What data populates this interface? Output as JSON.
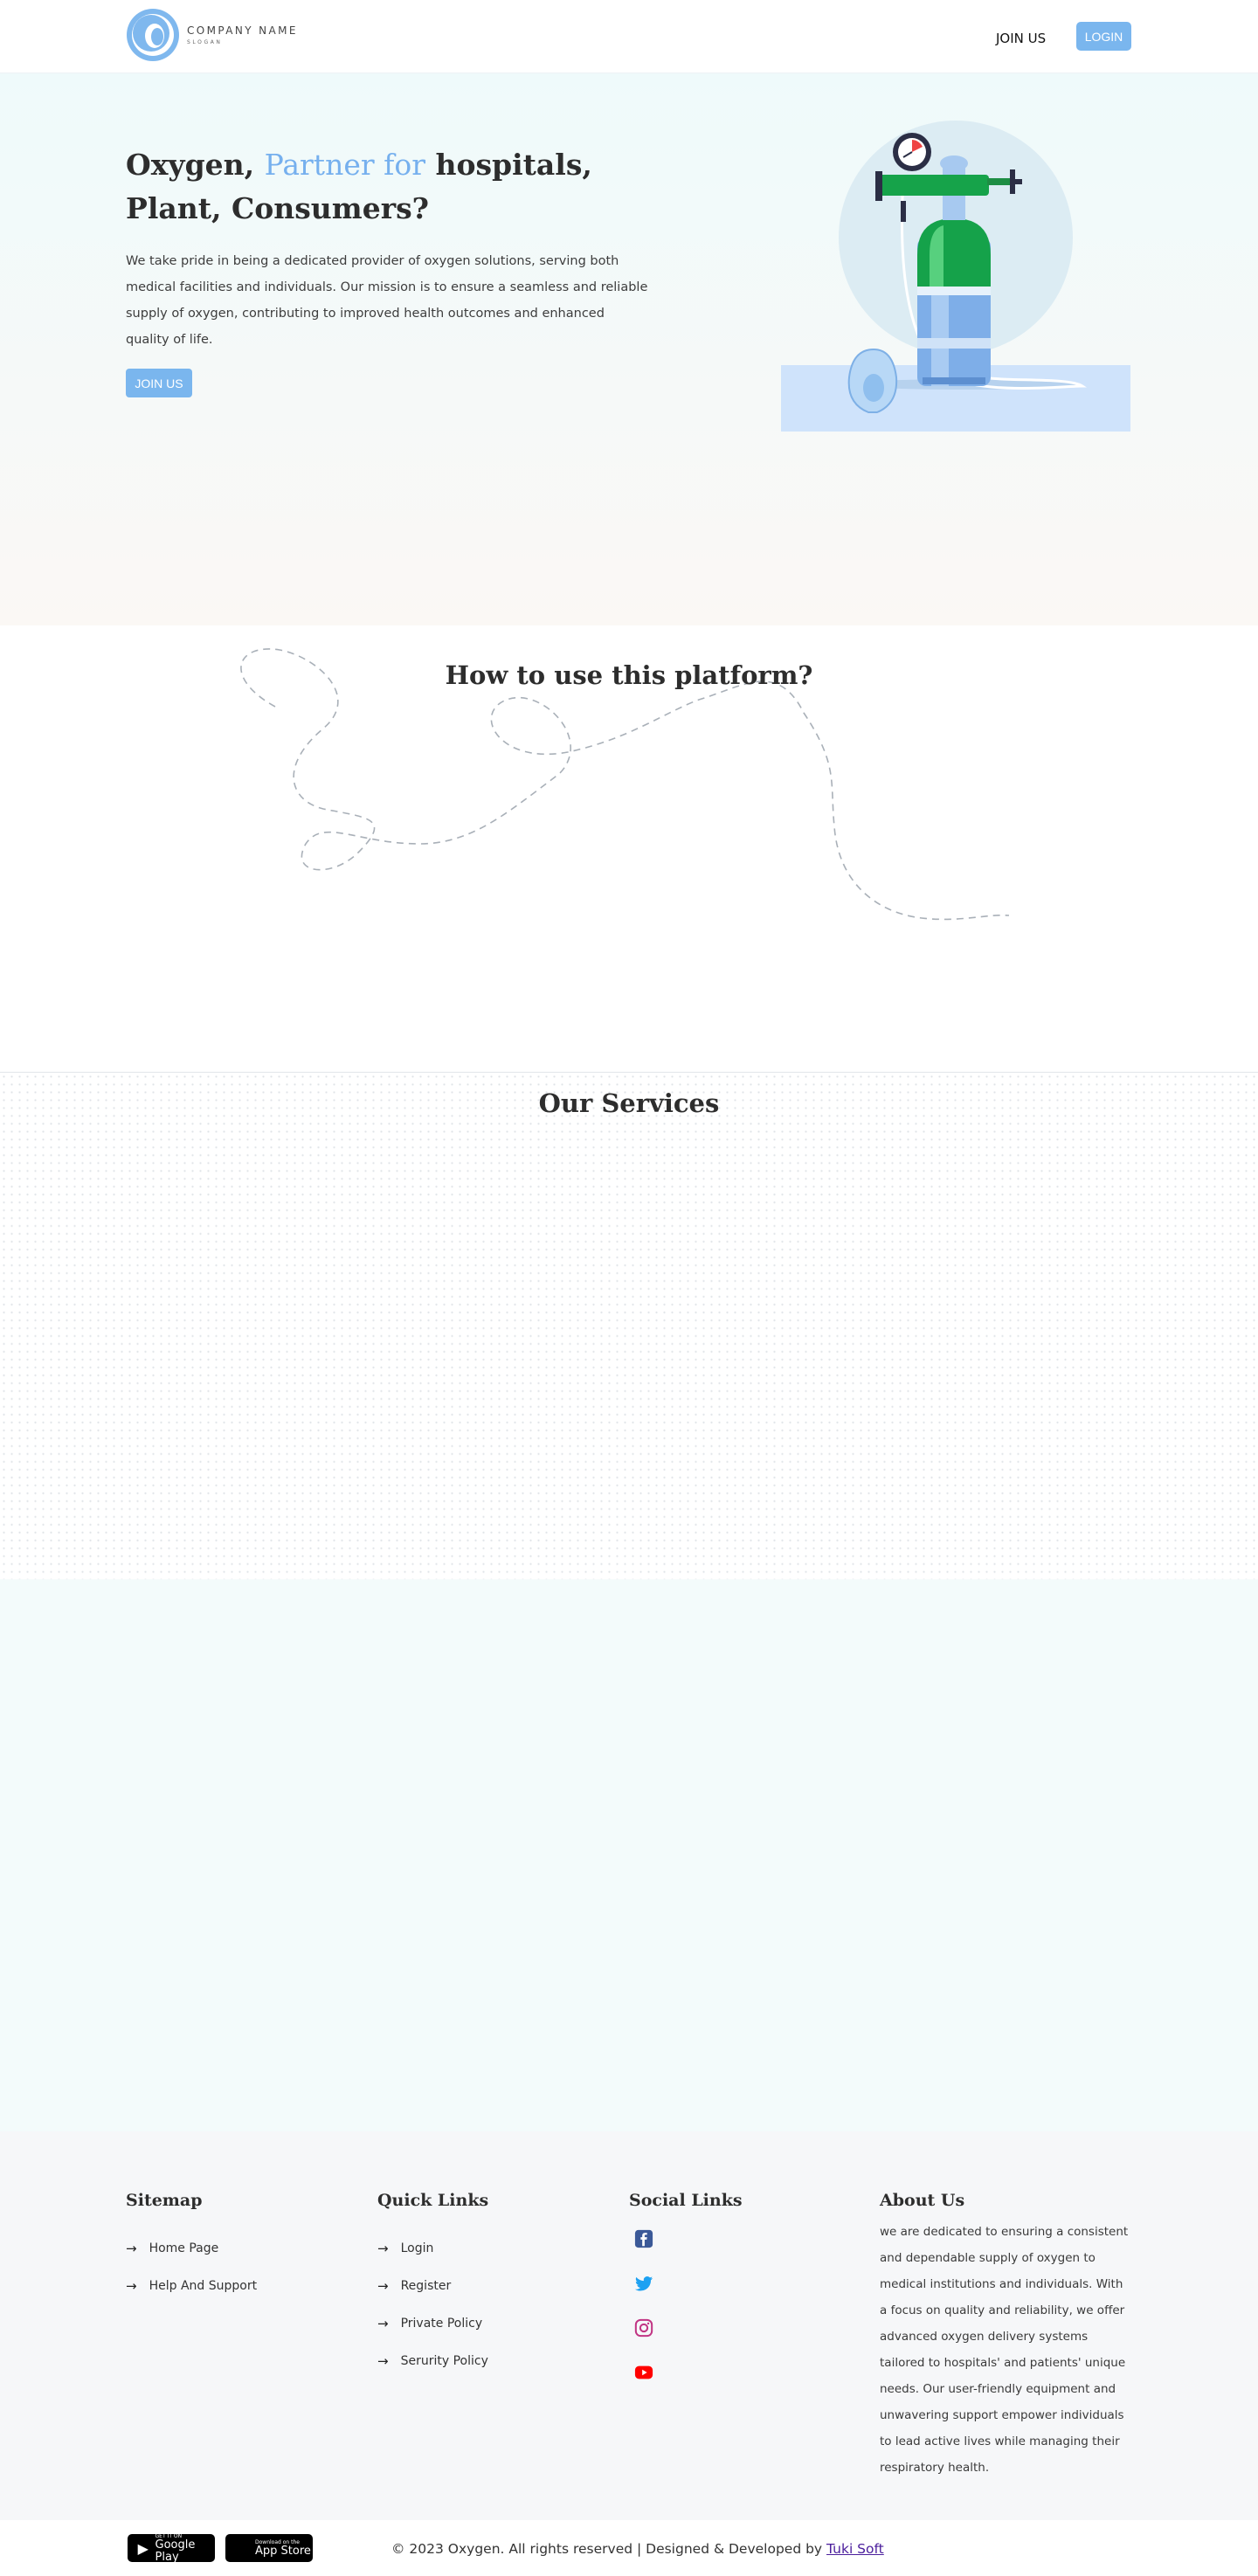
{
  "header": {
    "company_name": "COMPANY NAME",
    "slogan": "SLOGAN",
    "nav_join": "JOIN US",
    "nav_login": "LOGIN"
  },
  "hero": {
    "title_part1": "Oxygen, ",
    "title_accent": "Partner for",
    "title_part2": " hospitals, Plant, Consumers?",
    "description": "We take pride in being a dedicated provider of oxygen solutions, serving both medical facilities and individuals. Our mission is to ensure a seamless and reliable supply of oxygen, contributing to improved health outcomes and enhanced quality of life.",
    "join_button": "JOIN US"
  },
  "howto": {
    "title": "How to use this platform?"
  },
  "services": {
    "title": "Our Services"
  },
  "footer": {
    "sitemap": {
      "title": "Sitemap",
      "items": [
        {
          "label": "Home Page"
        },
        {
          "label": "Help And Support"
        }
      ]
    },
    "quick_links": {
      "title": "Quick Links",
      "items": [
        {
          "label": "Login"
        },
        {
          "label": "Register"
        },
        {
          "label": "Private Policy"
        },
        {
          "label": "Serurity Policy"
        }
      ]
    },
    "social_links": {
      "title": "Social Links",
      "items": [
        {
          "icon": "facebook-icon",
          "color": "#3b5998"
        },
        {
          "icon": "twitter-icon",
          "color": "#1da1f2"
        },
        {
          "icon": "instagram-icon",
          "color": "#c13584"
        },
        {
          "icon": "youtube-icon",
          "color": "#ff0000"
        }
      ]
    },
    "about": {
      "title": "About Us",
      "text": "we are dedicated to ensuring a consistent and dependable supply of oxygen to medical institutions and individuals. With a focus on quality and reliability, we offer advanced oxygen delivery systems tailored to hospitals' and patients' unique needs. Our user-friendly equipment and unwavering support empower individuals to lead active lives while managing their respiratory health."
    }
  },
  "bottom_bar": {
    "google_play_small": "GET IT ON",
    "google_play_big": "Google Play",
    "app_store_small": "Download on the",
    "app_store_big": "App Store",
    "copyright": "© 2023 Oxygen. All rights reserved | Designed & Developed by ",
    "developer": "Tuki Soft"
  },
  "colors": {
    "accent": "#76b0ee",
    "button": "#7ab6ee",
    "cylinder_green": "#13a34a",
    "footer_bg": "#f6f7f9"
  }
}
